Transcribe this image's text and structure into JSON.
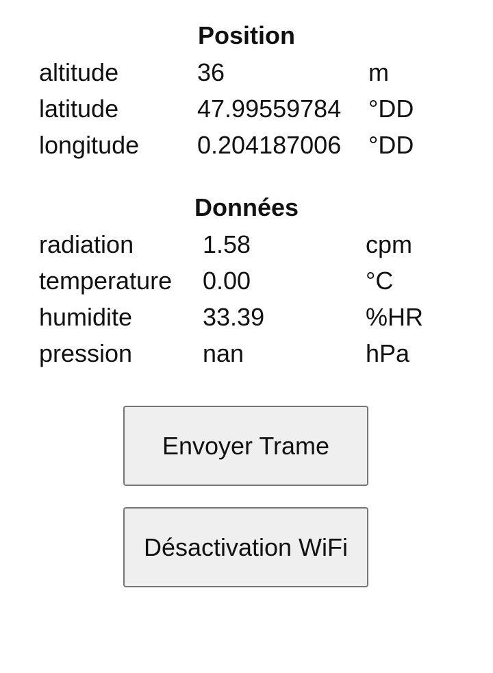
{
  "position": {
    "title": "Position",
    "rows": [
      {
        "label": "altitude",
        "value": "36",
        "unit": "m"
      },
      {
        "label": "latitude",
        "value": "47.99559784",
        "unit": "°DD"
      },
      {
        "label": "longitude",
        "value": "0.204187006",
        "unit": "°DD"
      }
    ]
  },
  "donnees": {
    "title": "Données",
    "rows": [
      {
        "label": "radiation",
        "value": "1.58",
        "unit": "cpm"
      },
      {
        "label": "temperature",
        "value": "0.00",
        "unit": "°C"
      },
      {
        "label": "humidite",
        "value": "33.39",
        "unit": "%HR"
      },
      {
        "label": "pression",
        "value": "nan",
        "unit": "hPa"
      }
    ]
  },
  "buttons": {
    "send_label": "Envoyer Trame",
    "wifi_label": "Désactivation WiFi"
  }
}
